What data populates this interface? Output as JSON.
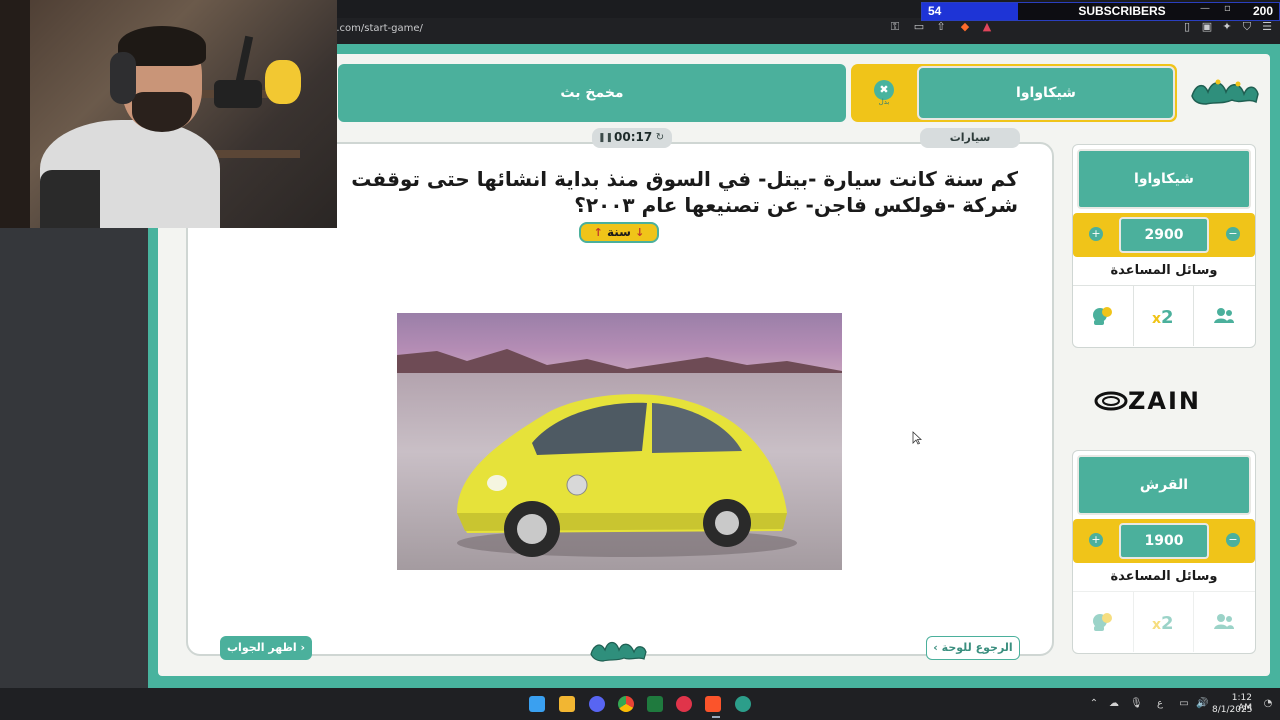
{
  "browser": {
    "url": "n.com/start-game/"
  },
  "subscribers": {
    "current": "54",
    "label": "SUBSCRIBERS",
    "goal": "200",
    "progress_fraction": 0.27
  },
  "header": {
    "team1_name": "شيكاواوا",
    "team2_name": "مخمخ بث",
    "team1_tag_text": "بدل"
  },
  "board": {
    "category": "سيارات",
    "timer": "00:17",
    "question": "كم سنة كانت سيارة -بيتل- في السوق منذ بداية انشائها حتى توقفت شركة -فولكس فاجن- عن تصنيعها عام ٢٠٠٣؟",
    "answer_type": "سنة",
    "show_answer": "اظهر الجواب ›",
    "back_to_board": "‹ الرجوع للوحة"
  },
  "teams": [
    {
      "name": "شيكاواوا",
      "score": "2900",
      "help_title": "وسائل المساعدة"
    },
    {
      "name": "القرش",
      "score": "1900",
      "help_title": "وسائل المساعدة"
    }
  ],
  "sponsor": "ZAIN",
  "taskbar": {
    "time": "1:12 AM",
    "date": "8/1/2025",
    "lang": "ع"
  },
  "colors": {
    "teal": "#48b39e",
    "yellow": "#f0c419",
    "sub_blue": "#1e34d6"
  }
}
